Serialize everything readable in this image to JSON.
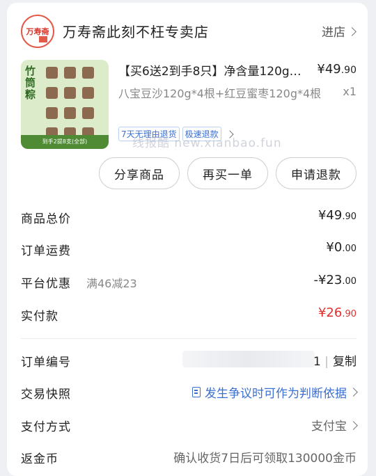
{
  "shop": {
    "name": "万寿斋此刻不枉专卖店",
    "logo_text": "万寿斋",
    "enter_label": "进店"
  },
  "product": {
    "thumb_title": "竹筒粽",
    "thumb_footer": "到手2提8支(全部)",
    "title": "【买6送2到手8只】净含量120g…",
    "price_symbol": "¥",
    "price_int": "49",
    "price_dec": ".90",
    "spec": "八宝豆沙120g*4根+红豆蜜枣120g*4根",
    "qty": "x1",
    "tags": [
      "7天无理由退货",
      "极速退款"
    ],
    "watermark": "线报酷 new.xianbao.fun"
  },
  "actions": {
    "share": "分享商品",
    "rebuy": "再买一单",
    "refund": "申请退款"
  },
  "summary": {
    "total_label": "商品总价",
    "total_int": "¥49",
    "total_dec": ".90",
    "shipping_label": "订单运费",
    "shipping_int": "¥0",
    "shipping_dec": ".00",
    "discount_label": "平台优惠",
    "discount_note": "满46减23",
    "discount_int": "-¥23",
    "discount_dec": ".00",
    "paid_label": "实付款",
    "paid_int": "¥26",
    "paid_dec": ".90"
  },
  "details": {
    "order_no_label": "订单编号",
    "order_no_tail": "1",
    "copy_label": "复制",
    "snapshot_label": "交易快照",
    "snapshot_value": "发生争议时可作为判断依据",
    "pay_method_label": "支付方式",
    "pay_method_value": "支付宝",
    "coins_label": "返金币",
    "coins_value": "确认收货7日后可领取130000金币"
  },
  "colors": {
    "accent_red": "#e0302e",
    "link_blue": "#3b6fd1"
  }
}
